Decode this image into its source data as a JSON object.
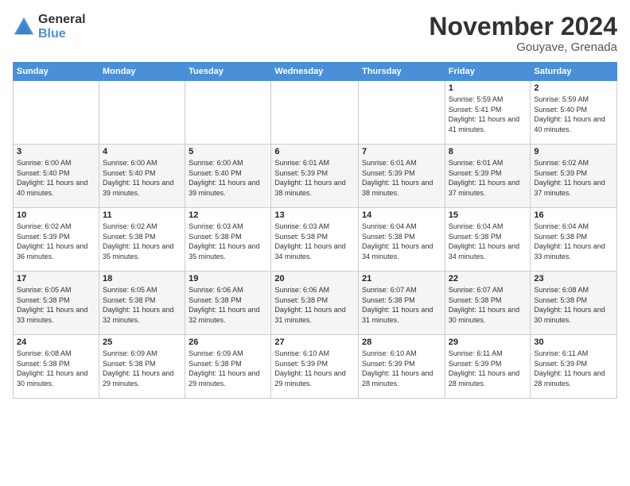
{
  "header": {
    "logo_general": "General",
    "logo_blue": "Blue",
    "month_title": "November 2024",
    "location": "Gouyave, Grenada"
  },
  "calendar": {
    "days_of_week": [
      "Sunday",
      "Monday",
      "Tuesday",
      "Wednesday",
      "Thursday",
      "Friday",
      "Saturday"
    ],
    "weeks": [
      [
        {
          "day": "",
          "info": ""
        },
        {
          "day": "",
          "info": ""
        },
        {
          "day": "",
          "info": ""
        },
        {
          "day": "",
          "info": ""
        },
        {
          "day": "",
          "info": ""
        },
        {
          "day": "1",
          "info": "Sunrise: 5:59 AM\nSunset: 5:41 PM\nDaylight: 11 hours and 41 minutes."
        },
        {
          "day": "2",
          "info": "Sunrise: 5:59 AM\nSunset: 5:40 PM\nDaylight: 11 hours and 40 minutes."
        }
      ],
      [
        {
          "day": "3",
          "info": "Sunrise: 6:00 AM\nSunset: 5:40 PM\nDaylight: 11 hours and 40 minutes."
        },
        {
          "day": "4",
          "info": "Sunrise: 6:00 AM\nSunset: 5:40 PM\nDaylight: 11 hours and 39 minutes."
        },
        {
          "day": "5",
          "info": "Sunrise: 6:00 AM\nSunset: 5:40 PM\nDaylight: 11 hours and 39 minutes."
        },
        {
          "day": "6",
          "info": "Sunrise: 6:01 AM\nSunset: 5:39 PM\nDaylight: 11 hours and 38 minutes."
        },
        {
          "day": "7",
          "info": "Sunrise: 6:01 AM\nSunset: 5:39 PM\nDaylight: 11 hours and 38 minutes."
        },
        {
          "day": "8",
          "info": "Sunrise: 6:01 AM\nSunset: 5:39 PM\nDaylight: 11 hours and 37 minutes."
        },
        {
          "day": "9",
          "info": "Sunrise: 6:02 AM\nSunset: 5:39 PM\nDaylight: 11 hours and 37 minutes."
        }
      ],
      [
        {
          "day": "10",
          "info": "Sunrise: 6:02 AM\nSunset: 5:39 PM\nDaylight: 11 hours and 36 minutes."
        },
        {
          "day": "11",
          "info": "Sunrise: 6:02 AM\nSunset: 5:38 PM\nDaylight: 11 hours and 35 minutes."
        },
        {
          "day": "12",
          "info": "Sunrise: 6:03 AM\nSunset: 5:38 PM\nDaylight: 11 hours and 35 minutes."
        },
        {
          "day": "13",
          "info": "Sunrise: 6:03 AM\nSunset: 5:38 PM\nDaylight: 11 hours and 34 minutes."
        },
        {
          "day": "14",
          "info": "Sunrise: 6:04 AM\nSunset: 5:38 PM\nDaylight: 11 hours and 34 minutes."
        },
        {
          "day": "15",
          "info": "Sunrise: 6:04 AM\nSunset: 5:38 PM\nDaylight: 11 hours and 34 minutes."
        },
        {
          "day": "16",
          "info": "Sunrise: 6:04 AM\nSunset: 5:38 PM\nDaylight: 11 hours and 33 minutes."
        }
      ],
      [
        {
          "day": "17",
          "info": "Sunrise: 6:05 AM\nSunset: 5:38 PM\nDaylight: 11 hours and 33 minutes."
        },
        {
          "day": "18",
          "info": "Sunrise: 6:05 AM\nSunset: 5:38 PM\nDaylight: 11 hours and 32 minutes."
        },
        {
          "day": "19",
          "info": "Sunrise: 6:06 AM\nSunset: 5:38 PM\nDaylight: 11 hours and 32 minutes."
        },
        {
          "day": "20",
          "info": "Sunrise: 6:06 AM\nSunset: 5:38 PM\nDaylight: 11 hours and 31 minutes."
        },
        {
          "day": "21",
          "info": "Sunrise: 6:07 AM\nSunset: 5:38 PM\nDaylight: 11 hours and 31 minutes."
        },
        {
          "day": "22",
          "info": "Sunrise: 6:07 AM\nSunset: 5:38 PM\nDaylight: 11 hours and 30 minutes."
        },
        {
          "day": "23",
          "info": "Sunrise: 6:08 AM\nSunset: 5:38 PM\nDaylight: 11 hours and 30 minutes."
        }
      ],
      [
        {
          "day": "24",
          "info": "Sunrise: 6:08 AM\nSunset: 5:38 PM\nDaylight: 11 hours and 30 minutes."
        },
        {
          "day": "25",
          "info": "Sunrise: 6:09 AM\nSunset: 5:38 PM\nDaylight: 11 hours and 29 minutes."
        },
        {
          "day": "26",
          "info": "Sunrise: 6:09 AM\nSunset: 5:38 PM\nDaylight: 11 hours and 29 minutes."
        },
        {
          "day": "27",
          "info": "Sunrise: 6:10 AM\nSunset: 5:39 PM\nDaylight: 11 hours and 29 minutes."
        },
        {
          "day": "28",
          "info": "Sunrise: 6:10 AM\nSunset: 5:39 PM\nDaylight: 11 hours and 28 minutes."
        },
        {
          "day": "29",
          "info": "Sunrise: 6:11 AM\nSunset: 5:39 PM\nDaylight: 11 hours and 28 minutes."
        },
        {
          "day": "30",
          "info": "Sunrise: 6:11 AM\nSunset: 5:39 PM\nDaylight: 11 hours and 28 minutes."
        }
      ]
    ]
  }
}
